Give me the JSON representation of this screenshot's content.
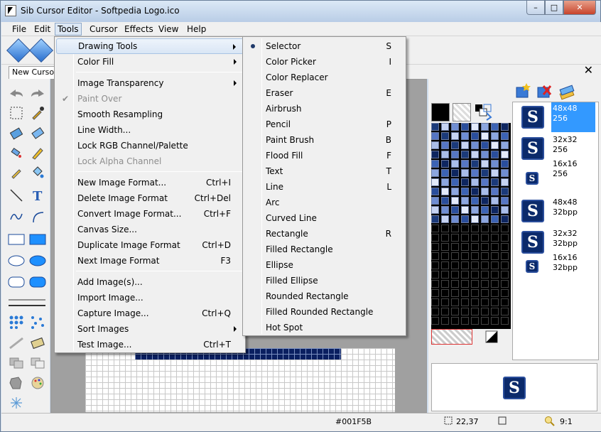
{
  "window": {
    "title": "Sib Cursor Editor - Softpedia Logo.ico",
    "minimize": "–",
    "maximize": "□",
    "close": "✕"
  },
  "menubar": [
    "File",
    "Edit",
    "Tools",
    "Cursor",
    "Effects",
    "View",
    "Help"
  ],
  "tab": {
    "label": "New Cursor"
  },
  "close_panel": "✕",
  "tools_menu": [
    {
      "label": "Drawing Tools",
      "submenu": true,
      "highlighted": true
    },
    {
      "label": "Color Fill",
      "submenu": true
    },
    {
      "sep": true
    },
    {
      "label": "Image Transparency",
      "submenu": true
    },
    {
      "label": "Paint Over",
      "disabled": true,
      "checked": true
    },
    {
      "label": "Smooth Resampling"
    },
    {
      "label": "Line Width..."
    },
    {
      "label": "Lock RGB Channel/Palette"
    },
    {
      "label": "Lock Alpha Channel",
      "disabled": true
    },
    {
      "sep": true
    },
    {
      "label": "New Image Format...",
      "shortcut": "Ctrl+I"
    },
    {
      "label": "Delete Image Format",
      "shortcut": "Ctrl+Del"
    },
    {
      "label": "Convert Image Format...",
      "shortcut": "Ctrl+F"
    },
    {
      "label": "Canvas Size..."
    },
    {
      "label": "Duplicate Image Format",
      "shortcut": "Ctrl+D"
    },
    {
      "label": "Next Image Format",
      "shortcut": "F3"
    },
    {
      "sep": true
    },
    {
      "label": "Add Image(s)..."
    },
    {
      "label": "Import Image..."
    },
    {
      "label": "Capture Image...",
      "shortcut": "Ctrl+Q"
    },
    {
      "label": "Sort Images",
      "submenu": true
    },
    {
      "label": "Test Image...",
      "shortcut": "Ctrl+T"
    }
  ],
  "drawing_menu": [
    {
      "label": "Selector",
      "shortcut": "S",
      "selected": true
    },
    {
      "label": "Color Picker",
      "shortcut": "I"
    },
    {
      "label": "Color Replacer"
    },
    {
      "label": "Eraser",
      "shortcut": "E"
    },
    {
      "label": "Airbrush"
    },
    {
      "label": "Pencil",
      "shortcut": "P"
    },
    {
      "label": "Paint Brush",
      "shortcut": "B"
    },
    {
      "label": "Flood Fill",
      "shortcut": "F"
    },
    {
      "label": "Text",
      "shortcut": "T"
    },
    {
      "label": "Line",
      "shortcut": "L"
    },
    {
      "label": "Arc"
    },
    {
      "label": "Curved Line"
    },
    {
      "label": "Rectangle",
      "shortcut": "R"
    },
    {
      "label": "Filled Rectangle"
    },
    {
      "label": "Ellipse"
    },
    {
      "label": "Filled Ellipse"
    },
    {
      "label": "Rounded Rectangle"
    },
    {
      "label": "Filled Rounded Rectangle"
    },
    {
      "label": "Hot Spot"
    }
  ],
  "images": [
    {
      "size": "48x48",
      "depth": "256",
      "selected": true
    },
    {
      "size": "32x32",
      "depth": "256"
    },
    {
      "size": "16x16",
      "depth": "256"
    },
    {
      "size": "48x48",
      "depth": "32bpp"
    },
    {
      "size": "32x32",
      "depth": "32bpp"
    },
    {
      "size": "16x16",
      "depth": "32bpp"
    }
  ],
  "icon_letter": "S",
  "status": {
    "color": "#001F5B",
    "coords": "22,37",
    "zoom": "9:1"
  },
  "colors": {
    "icon_bg": "#0b2a6b",
    "selection": "#3399ff",
    "menu_bg": "#f0f0f0"
  }
}
